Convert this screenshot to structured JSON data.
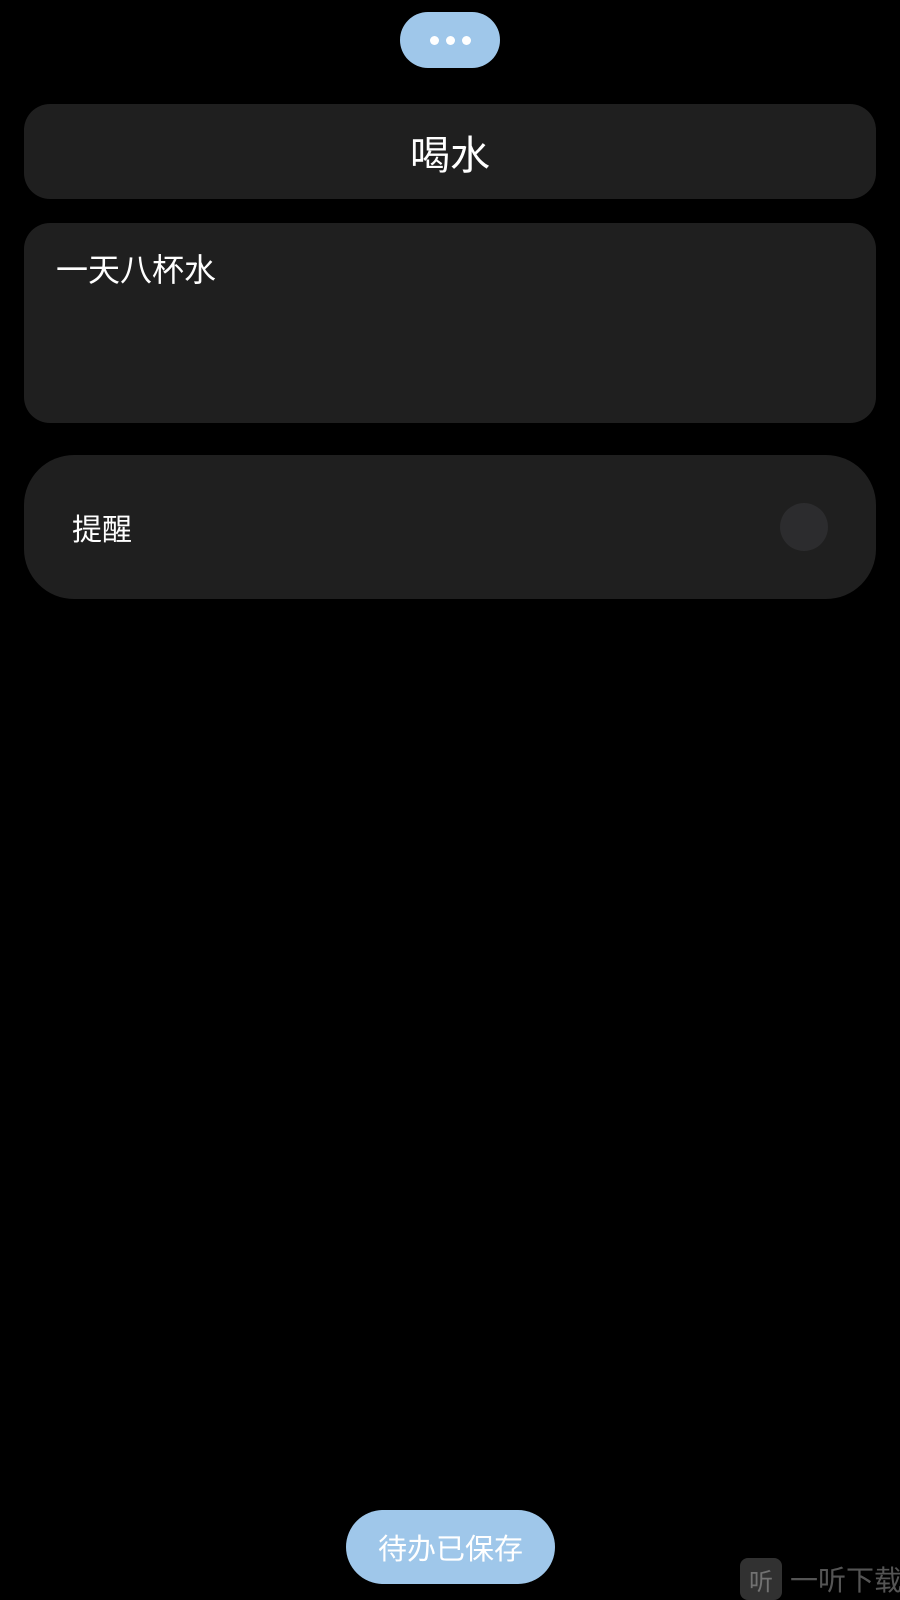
{
  "top_pill": {
    "icon": "more-dots-icon"
  },
  "title": {
    "text": "喝水"
  },
  "note": {
    "text": "一天八杯水"
  },
  "reminder": {
    "label": "提醒",
    "enabled": false
  },
  "toast": {
    "text": "待办已保存"
  },
  "watermark": {
    "logo": "听",
    "text": "一听下载"
  },
  "colors": {
    "background": "#000000",
    "card": "#1f1f1f",
    "accent": "#9fc7ea",
    "toggle_off": "#2c2c2e",
    "text": "#ffffff"
  }
}
